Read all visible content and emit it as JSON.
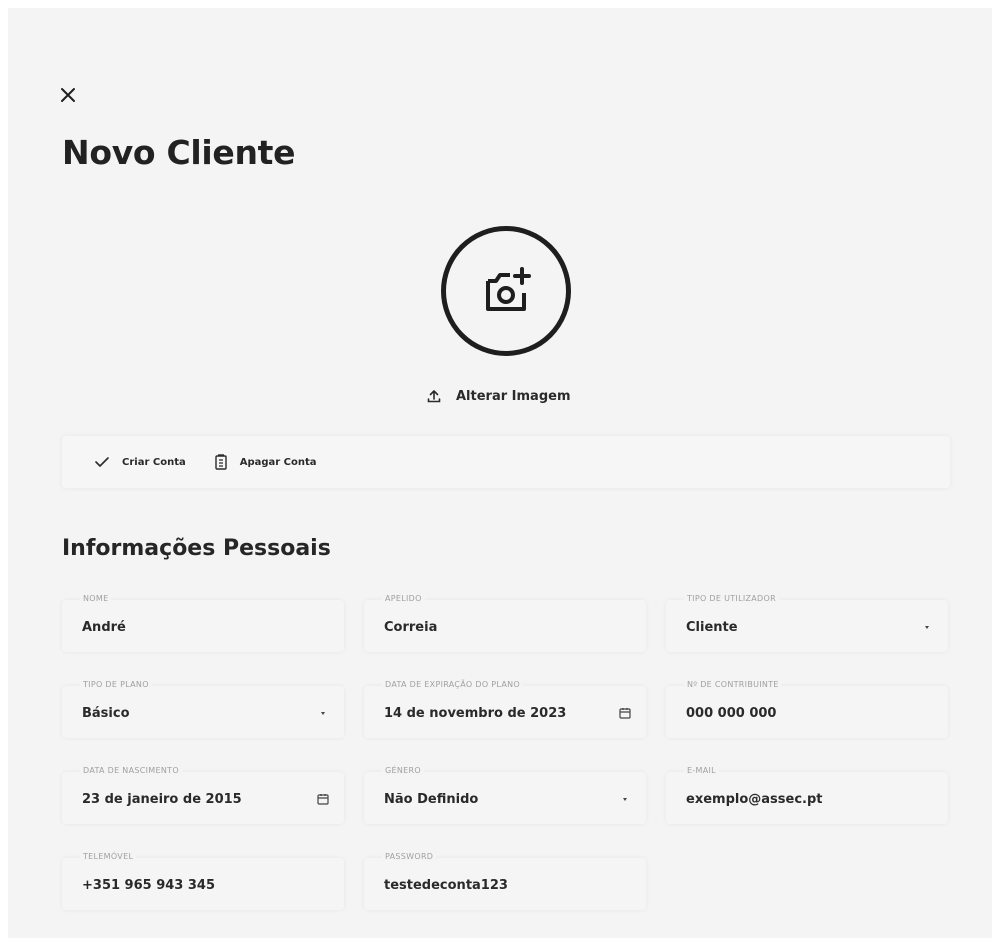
{
  "header": {
    "title": "Novo Cliente"
  },
  "avatar": {
    "change_label": "Alterar Imagem"
  },
  "toolbar": {
    "create_label": "Criar Conta",
    "delete_label": "Apagar Conta"
  },
  "section": {
    "title": "Informações Pessoais"
  },
  "fields": {
    "nome": {
      "label": "NOME",
      "value": "André"
    },
    "apelido": {
      "label": "APELIDO",
      "value": "Correia"
    },
    "tipo_utilizador": {
      "label": "TIPO DE UTILIZADOR",
      "value": "Cliente"
    },
    "tipo_plano": {
      "label": "TIPO DE PLANO",
      "value": "Básico"
    },
    "data_expiracao": {
      "label": "DATA DE EXPIRAÇÃO DO PLANO",
      "value": "14 de novembro de 2023"
    },
    "contribuinte": {
      "label": "Nº DE CONTRIBUINTE",
      "value": "000 000 000"
    },
    "data_nascimento": {
      "label": "DATA DE NASCIMENTO",
      "value": "23 de janeiro de 2015"
    },
    "genero": {
      "label": "GÉNERO",
      "value": "Não Definido"
    },
    "email": {
      "label": "E-MAIL",
      "value": "exemplo@assec.pt"
    },
    "telemovel": {
      "label": "TELEMÓVEL",
      "value": "+351 965 943 345"
    },
    "password": {
      "label": "PASSWORD",
      "value": "testedeconta123"
    }
  },
  "icons": {
    "close": "close-icon",
    "camera": "camera-plus-icon",
    "upload": "upload-icon",
    "check": "check-icon",
    "delete": "trash-icon",
    "calendar": "calendar-icon",
    "dropdown": "chevron-down-icon"
  }
}
